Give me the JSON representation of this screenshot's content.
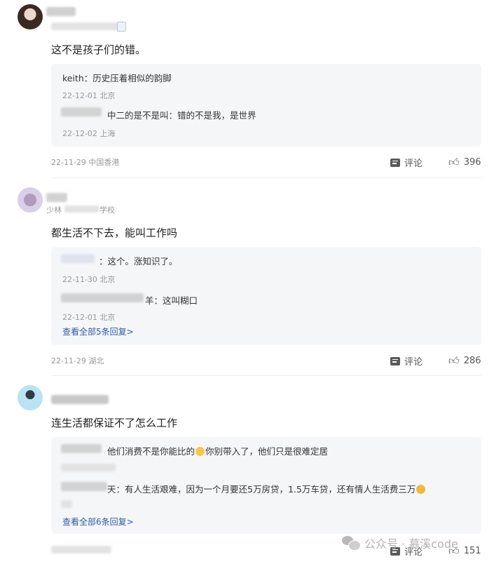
{
  "comments": [
    {
      "text": "这不是孩子们的错。",
      "replies": [
        {
          "name": "keith",
          "content": "：历史压着相似的韵脚",
          "meta": "22-12-01 北京"
        },
        {
          "name": "",
          "content": "中二的是不是叫：错的不是我，是世界",
          "meta": "22-12-02 上海"
        }
      ],
      "more_replies": "",
      "meta": "22-11-29 中国香港",
      "reply_label": "评论",
      "like_count": "396"
    },
    {
      "text": "都生活不下去，能叫工作吗",
      "replies": [
        {
          "name": "",
          "content": "：这个。涨知识了。",
          "meta": "22-11-30 北京"
        },
        {
          "name": "",
          "content": "羊：这叫糊口",
          "meta": "22-12-01 北京"
        }
      ],
      "more_replies": "查看全部5条回复>",
      "meta": "22-11-29 湖北",
      "reply_label": "评论",
      "like_count": "286"
    },
    {
      "text": "连生活都保证不了怎么工作",
      "replies": [
        {
          "name": "",
          "content": "他们消费不是你能比的",
          "content_after": "你别带入了，他们只是很难定居",
          "meta": ""
        },
        {
          "name": "天",
          "content": "：有人生活艰难，因为一个月要还5万房贷，1.5万车贷，还有情人生活费三万",
          "meta": ""
        }
      ],
      "more_replies": "查看全部6条回复>",
      "meta": "",
      "reply_label": "评论",
      "like_count": "151"
    }
  ],
  "partial_user_line_1": "少林",
  "partial_user_line_1b": "学校",
  "watermark": "公众号 · 慕溪code",
  "colors": {
    "link": "#2e5aa8",
    "muted": "#999999",
    "reply_bg": "#f5f6f8"
  },
  "icons": {
    "reply": "comment-icon",
    "like": "thumbs-up-icon",
    "watermark": "wechat-icon"
  }
}
